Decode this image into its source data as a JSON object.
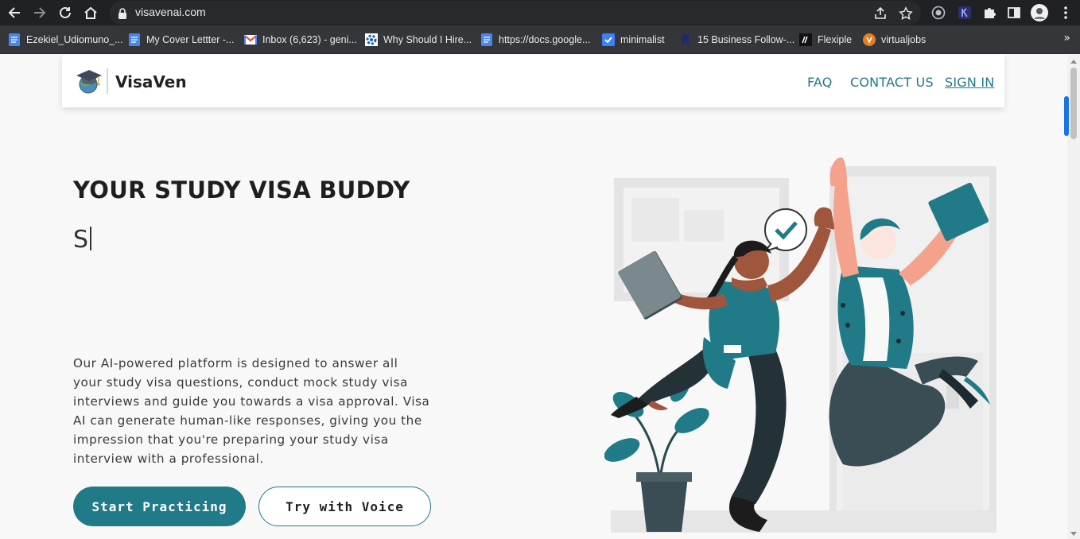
{
  "browser": {
    "url": "visavenai.com",
    "bookmarks": [
      {
        "label": "Ezekiel_Udiomuno_...",
        "icon": "docs-icon"
      },
      {
        "label": "My Cover Lettter -...",
        "icon": "docs-icon"
      },
      {
        "label": "Inbox (6,623) - geni...",
        "icon": "gmail-icon"
      },
      {
        "label": "Why Should I Hire...",
        "icon": "gear-icon"
      },
      {
        "label": "https://docs.google...",
        "icon": "docs-icon"
      },
      {
        "label": "minimalist",
        "icon": "checkbox-icon"
      },
      {
        "label": "15 Business Follow-...",
        "icon": "bookmark-icon"
      },
      {
        "label": "Flexiple",
        "icon": "flexiple-icon"
      },
      {
        "label": "virtualjobs",
        "icon": "virtualjobs-icon"
      }
    ]
  },
  "site": {
    "brand": "VisaVen",
    "nav": {
      "faq": "FAQ",
      "contact": "CONTACT US",
      "signin": "SIGN IN"
    }
  },
  "hero": {
    "title": "YOUR STUDY VISA BUDDY",
    "typed_text": "S",
    "description": "Our AI-powered platform is designed to answer all your study visa questions, conduct mock study visa interviews and guide you towards a visa approval. Visa AI can generate human-like responses, giving you the impression that you're preparing your study visa interview with a professional.",
    "primary_button": "Start Practicing",
    "secondary_button": "Try with Voice"
  },
  "colors": {
    "accent": "#217a87",
    "background": "#f8f8f8",
    "chrome": "#202124"
  }
}
